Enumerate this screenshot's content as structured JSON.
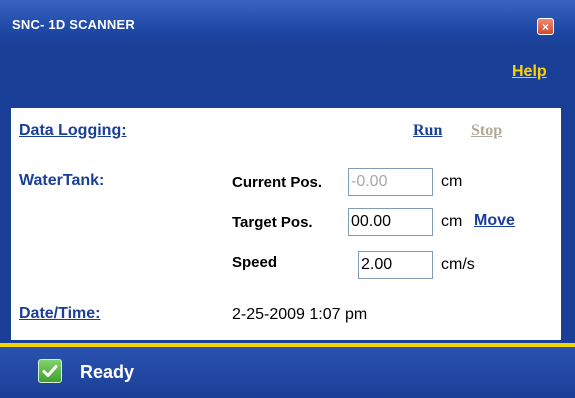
{
  "window": {
    "title": "SNC- 1D SCANNER",
    "close_symbol": "×",
    "help_label": "Help"
  },
  "logging": {
    "label": "Data Logging:",
    "run_label": "Run",
    "stop_label": "Stop"
  },
  "water_tank": {
    "label": "WaterTank:",
    "current_pos_label": "Current Pos.",
    "current_pos_value": "-0.00",
    "current_pos_unit": "cm",
    "target_pos_label": "Target Pos.",
    "target_pos_value": "00.00",
    "target_pos_unit": "cm",
    "move_label": "Move",
    "speed_label": "Speed",
    "speed_value": "2.00",
    "speed_unit": "cm/s"
  },
  "datetime": {
    "label": "Date/Time:",
    "value": "2-25-2009 1:07 pm"
  },
  "status": {
    "text": "Ready",
    "icon": "checkmark-icon"
  },
  "colors": {
    "window_blue": "#1a3f96",
    "help_yellow": "#ffd200",
    "divider_yellow": "#f2d500",
    "link_blue": "#1a3f96",
    "stop_disabled": "#b0a89a",
    "close_red": "#d04a2c",
    "ready_green": "#3ea02e"
  }
}
